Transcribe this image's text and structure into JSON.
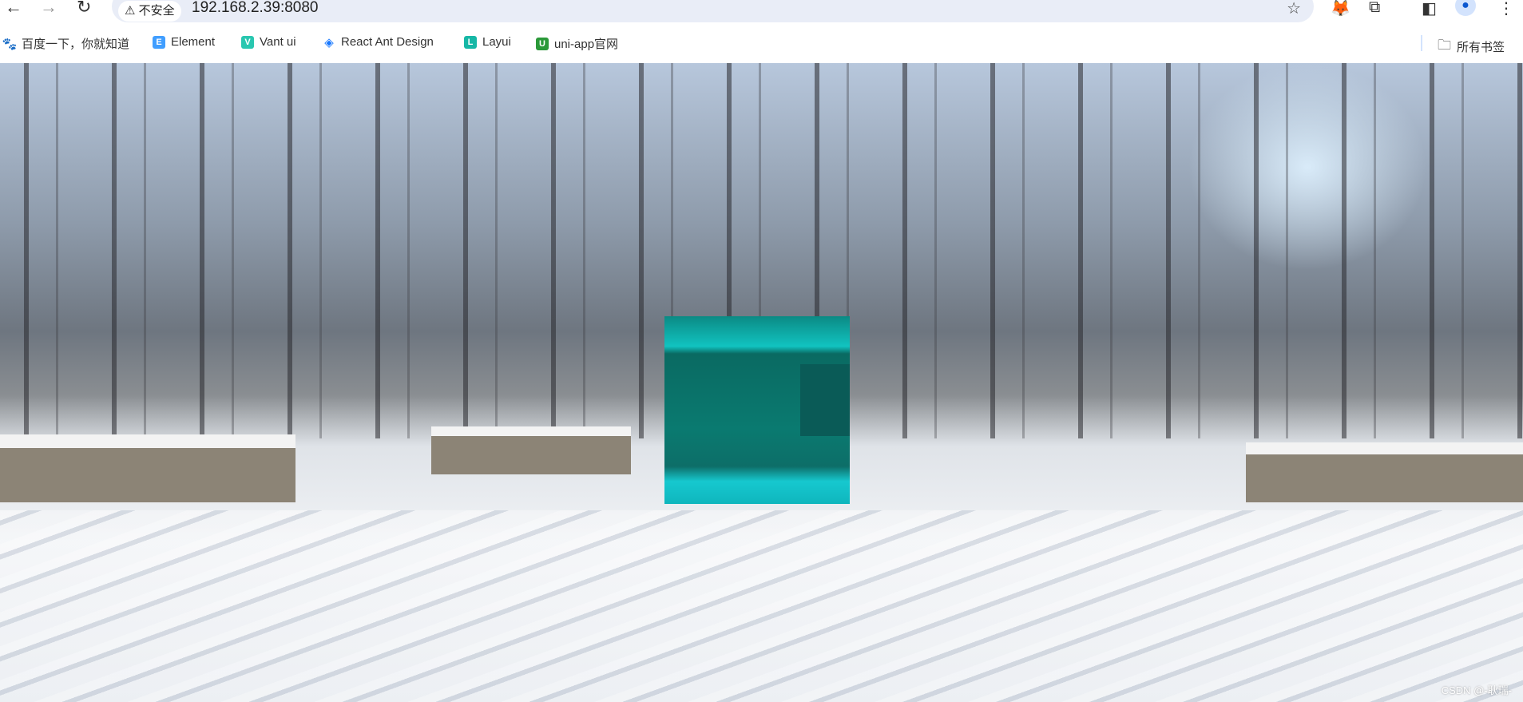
{
  "browser": {
    "security_label": "不安全",
    "url": "192.168.2.39:8080",
    "icons": [
      "back-icon",
      "forward-icon",
      "reload-icon",
      "warning-icon",
      "star-icon",
      "metamask-icon",
      "extensions-icon",
      "side-panel-icon",
      "profile-icon",
      "menu-icon"
    ]
  },
  "bookmarks": {
    "items": [
      {
        "label": "百度一下，你就知道",
        "icon": "baidu-icon",
        "color": "#2932e1"
      },
      {
        "label": "Element",
        "icon": "element-icon",
        "color": "#409eff"
      },
      {
        "label": "Vant ui",
        "icon": "vant-icon",
        "color": "#07c160"
      },
      {
        "label": "React Ant Design",
        "icon": "ant-design-icon",
        "color": "#1677ff"
      },
      {
        "label": "Layui",
        "icon": "layui-icon",
        "color": "#16b7a6"
      },
      {
        "label": "uni-app官网",
        "icon": "uniapp-icon",
        "color": "#2b9939"
      }
    ],
    "all_bookmarks": "所有书签"
  },
  "page": {
    "watermark": "CSDN @-耿瑞-",
    "cube_color": "#11c3c0"
  }
}
